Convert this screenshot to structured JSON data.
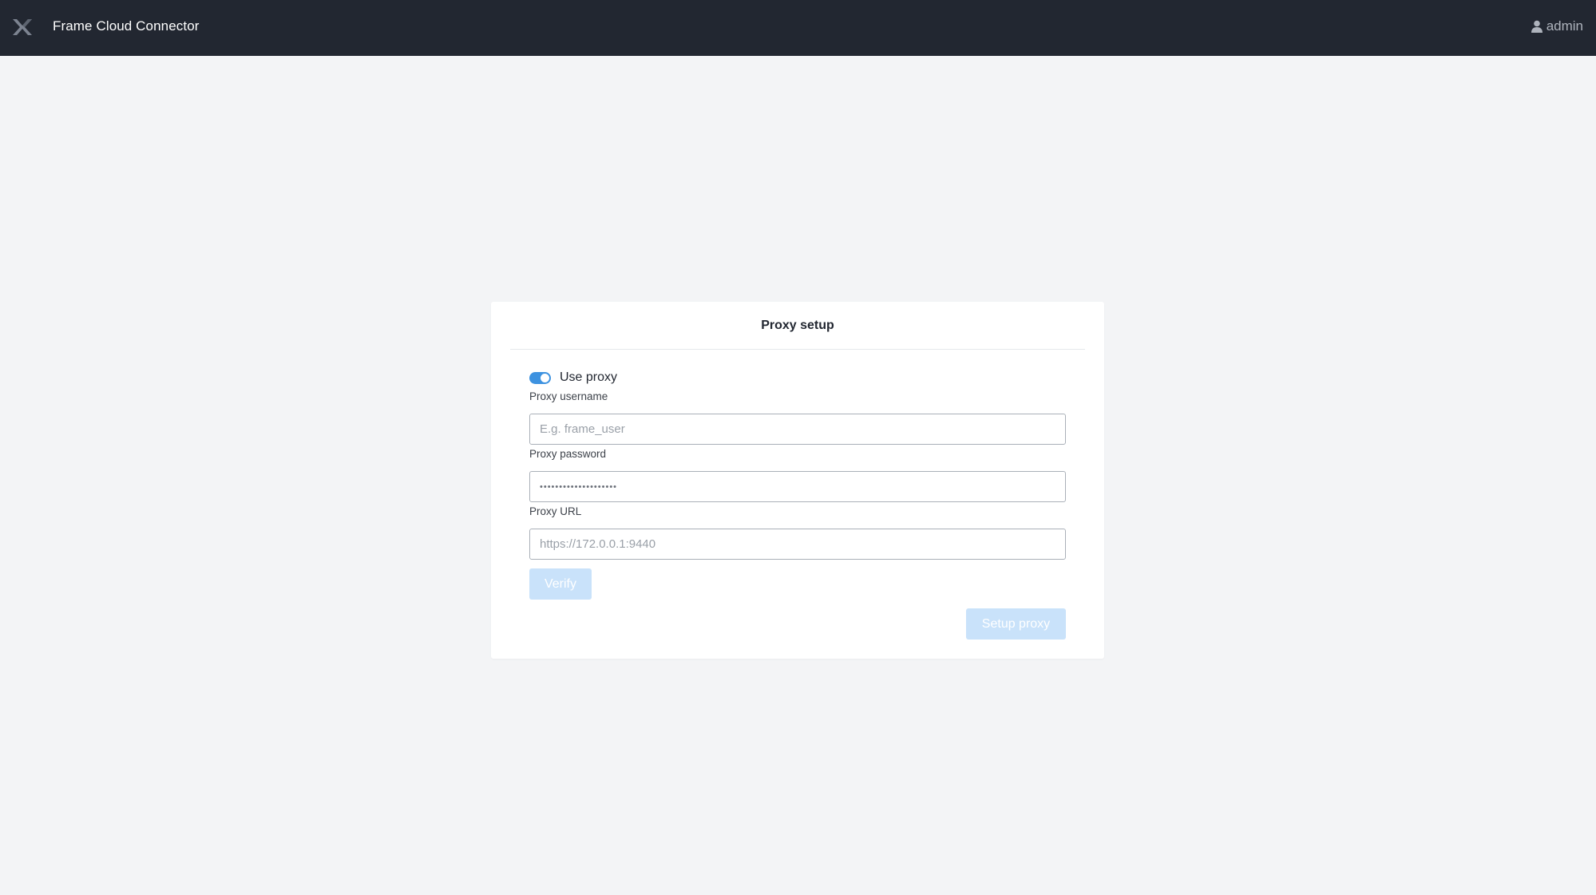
{
  "header": {
    "app_title": "Frame Cloud Connector",
    "logo_icon": "nutanix-x-logo-icon",
    "user": {
      "icon": "user-icon",
      "name": "admin"
    }
  },
  "card": {
    "title": "Proxy setup",
    "use_proxy": {
      "label": "Use proxy",
      "enabled": true
    },
    "fields": {
      "username": {
        "label": "Proxy username",
        "placeholder": "E.g. frame_user",
        "value": ""
      },
      "password": {
        "label": "Proxy password",
        "value": "••••••••••••••••••••"
      },
      "url": {
        "label": "Proxy URL",
        "placeholder": "https://172.0.0.1:9440",
        "value": ""
      }
    },
    "verify_label": "Verify",
    "setup_label": "Setup proxy"
  },
  "colors": {
    "topbar": "#222731",
    "background": "#f3f4f6",
    "accent": "#3d92e0",
    "button_disabled": "#c9e2fa"
  }
}
